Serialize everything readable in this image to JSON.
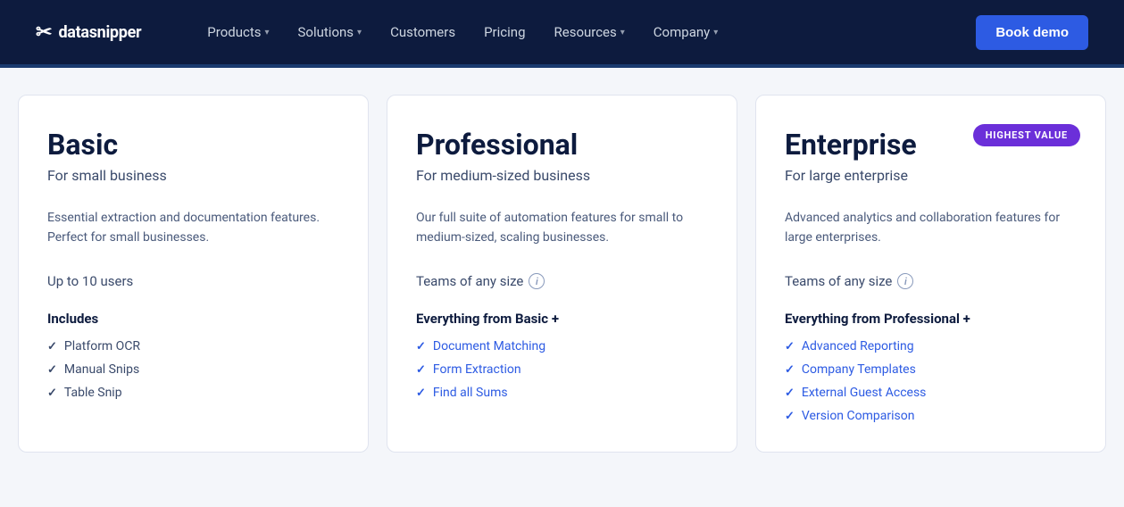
{
  "nav": {
    "logo_icon": "✂",
    "logo_text": "datasnipper",
    "links": [
      {
        "label": "Products",
        "has_dropdown": true
      },
      {
        "label": "Solutions",
        "has_dropdown": true
      },
      {
        "label": "Customers",
        "has_dropdown": false
      },
      {
        "label": "Pricing",
        "has_dropdown": false
      },
      {
        "label": "Resources",
        "has_dropdown": true
      },
      {
        "label": "Company",
        "has_dropdown": true
      }
    ],
    "cta_label": "Book demo"
  },
  "pricing": {
    "cards": [
      {
        "id": "basic",
        "name": "Basic",
        "subtitle": "For small business",
        "description": "Essential extraction and documentation features. Perfect for small businesses.",
        "users_text": "Up to 10 users",
        "users_info": false,
        "includes_heading": "Includes",
        "features": [
          {
            "label": "Platform OCR",
            "link": false
          },
          {
            "label": "Manual Snips",
            "link": false
          },
          {
            "label": "Table Snip",
            "link": false
          }
        ],
        "badge": null
      },
      {
        "id": "professional",
        "name": "Professional",
        "subtitle": "For medium-sized business",
        "description": "Our full suite of automation features for small to medium-sized, scaling businesses.",
        "users_text": "Teams of any size",
        "users_info": true,
        "includes_heading": "Everything from Basic +",
        "features": [
          {
            "label": "Document Matching",
            "link": true
          },
          {
            "label": "Form Extraction",
            "link": true
          },
          {
            "label": "Find all Sums",
            "link": true
          }
        ],
        "badge": null
      },
      {
        "id": "enterprise",
        "name": "Enterprise",
        "subtitle": "For large enterprise",
        "description": "Advanced analytics and collaboration features for large enterprises.",
        "users_text": "Teams of any size",
        "users_info": true,
        "includes_heading": "Everything from Professional +",
        "features": [
          {
            "label": "Advanced Reporting",
            "link": true
          },
          {
            "label": "Company Templates",
            "link": true
          },
          {
            "label": "External Guest Access",
            "link": true
          },
          {
            "label": "Version Comparison",
            "link": true
          }
        ],
        "badge": "HIGHEST VALUE"
      }
    ]
  }
}
